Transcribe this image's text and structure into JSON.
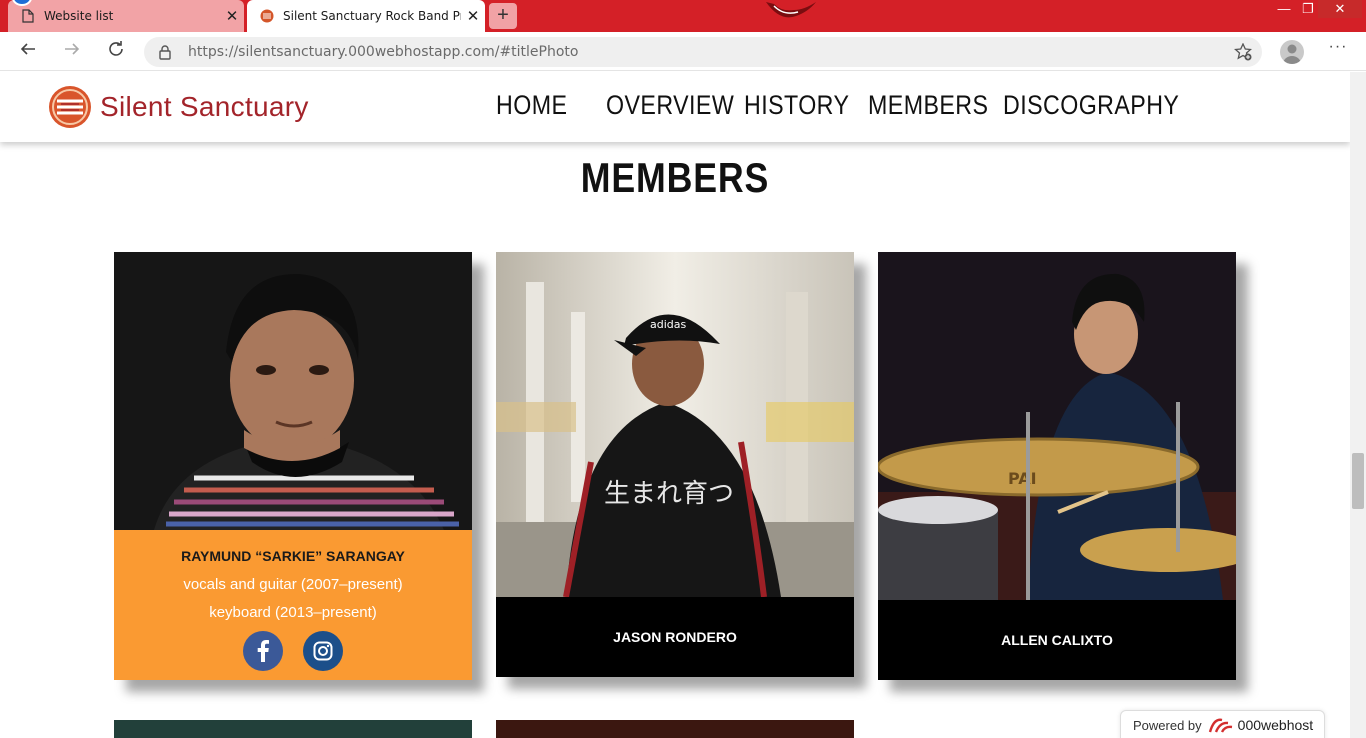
{
  "browser": {
    "tabs": [
      {
        "title": "Website list",
        "close_label": "✕"
      },
      {
        "title": "Silent Sanctuary Rock Band Profi",
        "close_label": "✕"
      }
    ],
    "new_tab_label": "+",
    "url_host": "https://silentsanctuary.000webhostapp.com/",
    "url_fragment": "#titlePhoto",
    "window_controls": {
      "minimize": "—",
      "maximize": "❐",
      "close": "✕"
    }
  },
  "site": {
    "brand_name": "Silent Sanctuary",
    "brand_color": "#a3242a",
    "nav": [
      {
        "label": "HOME"
      },
      {
        "label": "OVERVIEW"
      },
      {
        "label": "HISTORY"
      },
      {
        "label": "MEMBERS"
      },
      {
        "label": "DISCOGRAPHY"
      }
    ]
  },
  "members_section": {
    "title": "MEMBERS",
    "accent_color": "#fa9a32",
    "cards": [
      {
        "name": "RAYMUND “SARKIE” SARANGAY",
        "roles": [
          "vocals and guitar (2007–present)",
          "keyboard (2013–present)"
        ],
        "socials": [
          {
            "icon": "facebook-icon"
          },
          {
            "icon": "instagram-icon"
          }
        ]
      },
      {
        "name": "JASON RONDERO"
      },
      {
        "name": "ALLEN CALIXTO"
      }
    ]
  },
  "hosting_badge": {
    "label": "Powered by",
    "brand": "000webhost"
  }
}
